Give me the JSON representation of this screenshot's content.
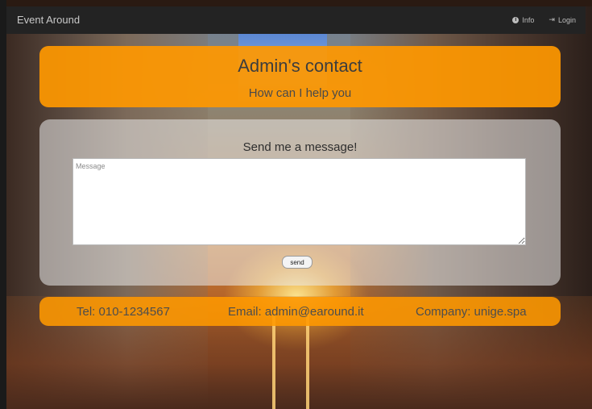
{
  "navbar": {
    "brand": "Event Around",
    "links": [
      {
        "label": "Info",
        "icon": "info-icon"
      },
      {
        "label": "Login",
        "icon": "login-icon"
      }
    ]
  },
  "header": {
    "title": "Admin's contact",
    "subtitle": "How can I help you"
  },
  "message_form": {
    "title": "Send me a message!",
    "placeholder": "Message",
    "value": "",
    "send_label": "send"
  },
  "footer": {
    "tel": "Tel: 010-1234567",
    "email": "Email: admin@earound.it",
    "company": "Company: unige.spa"
  },
  "colors": {
    "accent": "#FF9800",
    "navbar": "#232323"
  }
}
